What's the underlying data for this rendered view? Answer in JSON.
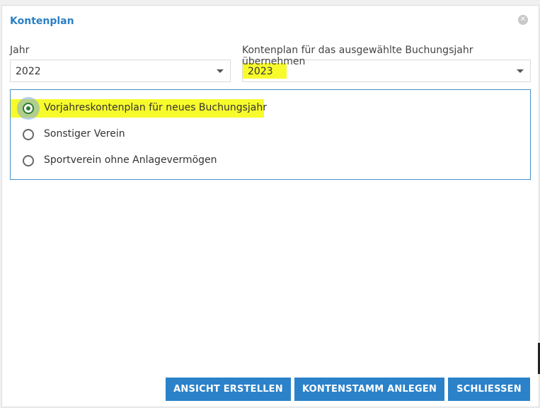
{
  "dialog": {
    "title": "Kontenplan",
    "close_glyph": "✕"
  },
  "fields": {
    "year_label": "Jahr",
    "year_value": "2022",
    "target_label": "Kontenplan für das ausgewählte Buchungsjahr übernehmen",
    "target_value": "2023"
  },
  "options": [
    {
      "label": "Vorjahreskontenplan für neues Buchungsjahr",
      "selected": true
    },
    {
      "label": "Sonstiger Verein",
      "selected": false
    },
    {
      "label": "Sportverein ohne Anlagevermögen",
      "selected": false
    }
  ],
  "buttons": {
    "create_view": "ANSICHT ERSTELLEN",
    "create_accounts": "KONTENSTAMM ANLEGEN",
    "close": "SCHLIESSEN"
  },
  "colors": {
    "accent": "#2b82c9",
    "title": "#2a7fc4",
    "highlight": "#f7fb2b",
    "radio_selected": "#2e7d32"
  },
  "icons": {
    "close": "close-circle-icon",
    "dropdown": "chevron-down-icon"
  }
}
